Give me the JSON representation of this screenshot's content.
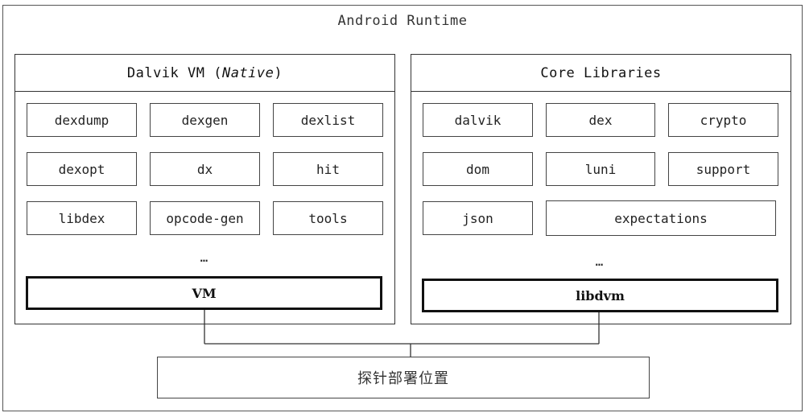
{
  "diagram": {
    "title": "Android Runtime",
    "left_panel": {
      "title_prefix": "Dalvik VM (",
      "title_italic": "Native",
      "title_suffix": ")",
      "modules": [
        "dexdump",
        "dexgen",
        "dexlist",
        "dexopt",
        "dx",
        "hit",
        "libdex",
        "opcode-gen",
        "tools"
      ],
      "ellipsis": "…",
      "core_module": "VM"
    },
    "right_panel": {
      "title": "Core Libraries",
      "modules": [
        "dalvik",
        "dex",
        "crypto",
        "dom",
        "luni",
        "support",
        "json",
        "expectations"
      ],
      "ellipsis": "…",
      "core_module": "libdvm"
    },
    "bottom_box": "探针部署位置"
  }
}
